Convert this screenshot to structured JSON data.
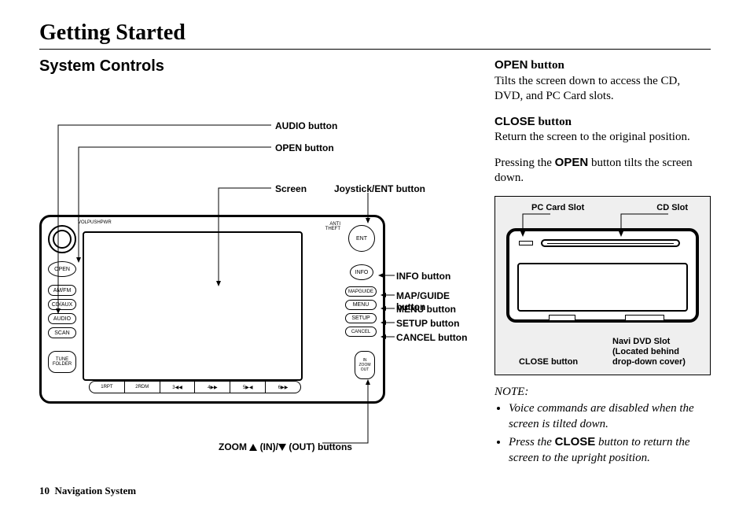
{
  "page": {
    "title": "Getting Started",
    "section": "System Controls",
    "footer_page": "10",
    "footer_label": "Navigation System"
  },
  "diagram": {
    "vol_label": "VOLPUSHPWR",
    "antitheft": "ANTI\nTHEFT",
    "open": "OPEN",
    "amfm": "AM/FM",
    "cdaux": "CD/AUX",
    "audio": "AUDIO",
    "scan": "SCAN",
    "tune": "TUNE\nFOLDER",
    "ent": "ENT",
    "info": "INFO",
    "mapguide": "MAPGUIDE",
    "menu": "MENU",
    "setup": "SETUP",
    "cancel": "CANCEL",
    "zoom": "IN\nZOOM\nOUT",
    "presets": [
      "1RPT",
      "2RDM",
      "3◀◀",
      "4▶▶",
      "5▶◀",
      "6▶▶"
    ]
  },
  "callouts": {
    "audio": "AUDIO button",
    "open": "OPEN button",
    "screen": "Screen",
    "joystick": "Joystick/ENT button",
    "info": "INFO button",
    "mapguide": "MAP/GUIDE button",
    "menu": "MENU button",
    "setup": "SETUP button",
    "cancel": "CANCEL button",
    "zoom_prefix": "ZOOM ",
    "zoom_in": " (IN)/",
    "zoom_out": " (OUT) buttons"
  },
  "right": {
    "open_head_bold": "OPEN",
    "open_head_rest": " button",
    "open_body": "Tilts the screen down to access the CD, DVD, and PC Card slots.",
    "close_head_bold": "CLOSE",
    "close_head_rest": " button",
    "close_body": "Return the screen to the original position.",
    "press_pre": "Pressing the ",
    "press_bold": "OPEN",
    "press_post": " button tilts the screen down.",
    "inset": {
      "pc": "PC Card Slot",
      "cd": "CD Slot",
      "close": "CLOSE button",
      "dvd": "Navi DVD Slot (Located behind drop-down cover)"
    },
    "note_title": "NOTE:",
    "note1": "Voice commands are disabled when the screen is tilted down.",
    "note2_pre": "Press the ",
    "note2_bold": "CLOSE",
    "note2_post": " button to return the screen to the upright position."
  }
}
